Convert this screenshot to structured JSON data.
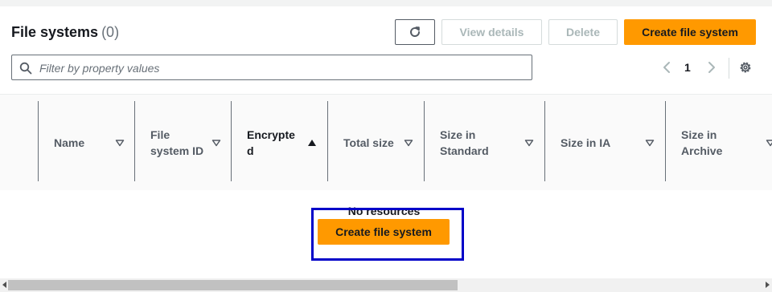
{
  "header": {
    "title": "File systems",
    "count": "(0)",
    "view_details_label": "View details",
    "delete_label": "Delete",
    "create_label": "Create file system"
  },
  "search": {
    "placeholder": "Filter by property values",
    "value": ""
  },
  "pagination": {
    "current_page": "1"
  },
  "table": {
    "columns": [
      {
        "label": "Name",
        "sort": "none"
      },
      {
        "label": "File\nsystem ID",
        "sort": "none"
      },
      {
        "label": "Encrypte\nd",
        "sort": "ascending"
      },
      {
        "label": "Total size",
        "sort": "none"
      },
      {
        "label": "Size in\nStandard",
        "sort": "none"
      },
      {
        "label": "Size in IA",
        "sort": "none"
      },
      {
        "label": "Size in\nArchive",
        "sort": "none"
      }
    ]
  },
  "empty_state": {
    "message": "No resources",
    "create_label": "Create file system"
  },
  "icons": {
    "refresh": "refresh-icon",
    "search": "search-icon",
    "prev": "chevron-left-icon",
    "next": "chevron-right-icon",
    "settings": "gear-icon",
    "sort_none": "caret-down-icon",
    "sort_asc": "caret-up-icon"
  },
  "colors": {
    "primary_button": "#ff9900",
    "highlight_box": "#0000c8",
    "disabled_text": "#aab7b8"
  }
}
